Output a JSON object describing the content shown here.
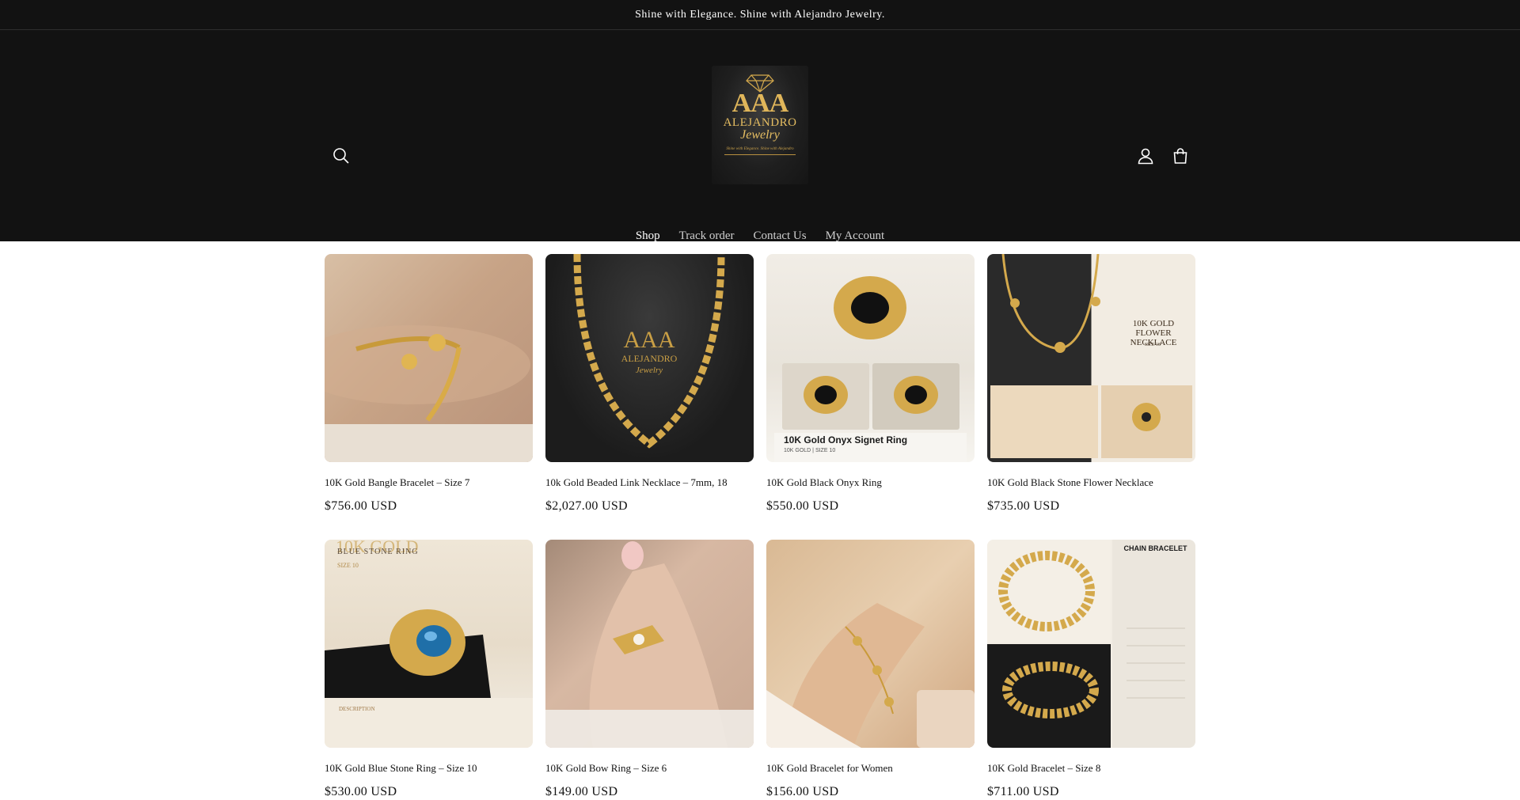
{
  "announcement": {
    "text": "Shine with Elegance. Shine with Alejandro Jewelry."
  },
  "logo": {
    "mark": "AAA",
    "name": "ALEJANDRO",
    "subname": "Jewelry",
    "tagline": "Shine with Elegance. Shine with Alejandro"
  },
  "header": {
    "icons": [
      "search-icon",
      "account-icon",
      "cart-icon"
    ]
  },
  "nav": {
    "items": [
      {
        "label": "Shop",
        "active": true
      },
      {
        "label": "Track order"
      },
      {
        "label": "Contact Us"
      },
      {
        "label": "My Account"
      }
    ]
  },
  "products": [
    {
      "title": "10K Gold Bangle Bracelet – Size 7",
      "price": "$756.00 USD"
    },
    {
      "title": "10k Gold Beaded Link Necklace – 7mm, 18",
      "price": "$2,027.00 USD"
    },
    {
      "title": "10K Gold Black Onyx Ring",
      "price": "$550.00 USD"
    },
    {
      "title": "10K Gold Black Stone Flower Necklace",
      "price": "$735.00 USD"
    },
    {
      "title": "10K Gold Blue Stone Ring – Size 10",
      "price": "$530.00 USD"
    },
    {
      "title": "10K Gold Bow Ring – Size 6",
      "price": "$149.00 USD"
    },
    {
      "title": "10K Gold Bracelet for Women",
      "price": "$156.00 USD"
    },
    {
      "title": "10K Gold Bracelet – Size 8",
      "price": "$711.00 USD"
    }
  ],
  "product_image_text": {
    "onyx_caption": "10K Gold Onyx Signet Ring",
    "onyx_sub": "10K GOLD | SIZE 10",
    "flower_title": "10K GOLD FLOWER NECKLACE",
    "flower_size": "SIZE 18\"",
    "blue_title": "10K GOLD",
    "blue_sub": "BLUE STONE RING",
    "blue_size": "SIZE 10",
    "blue_desc": "DESCRIPTION",
    "chain_title": "CHAIN BRACELET"
  },
  "colors": {
    "header_bg": "#121212",
    "gold": "#d4a94c",
    "text": "#121212"
  }
}
